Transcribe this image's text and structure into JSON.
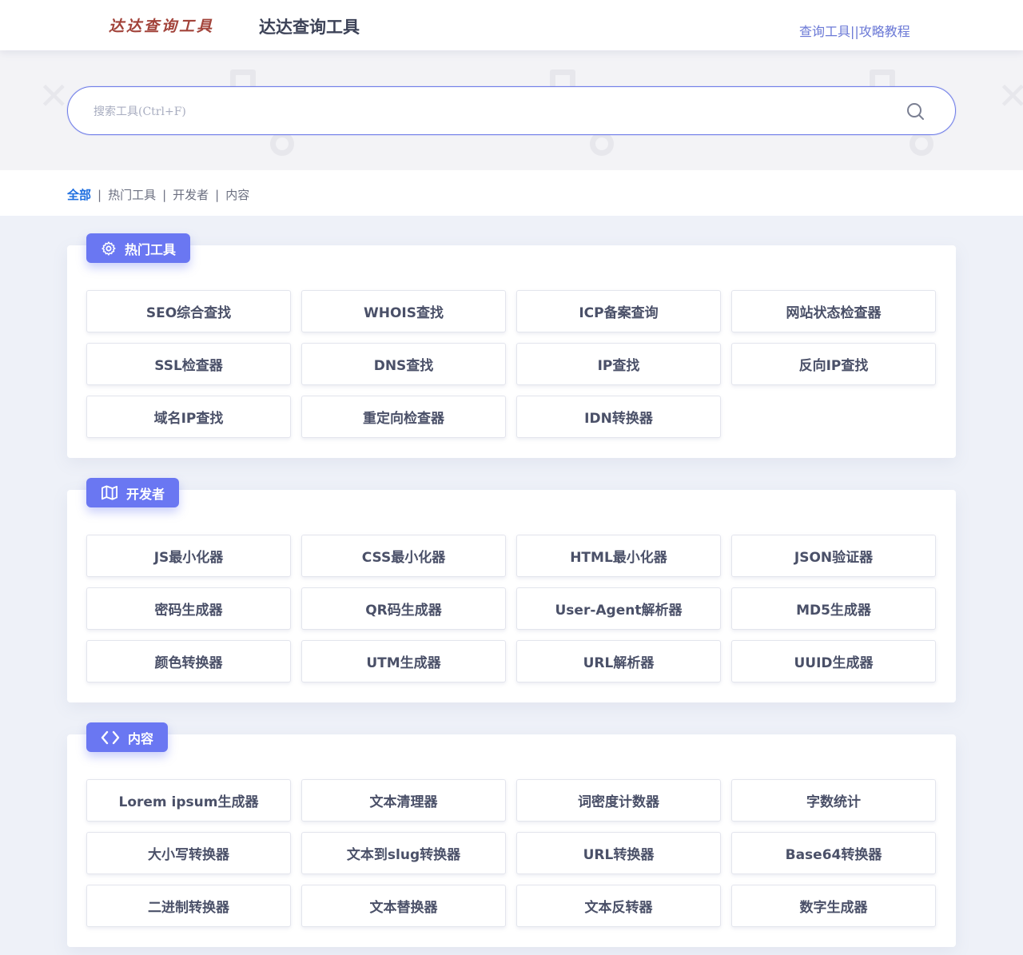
{
  "header": {
    "logo_text": "达达查询工具",
    "site_title": "达达查询工具",
    "links": [
      "查询工具|",
      "|攻略教程"
    ]
  },
  "search": {
    "placeholder": "搜索工具(Ctrl+F)",
    "icon": "search-icon"
  },
  "filters": [
    "全部",
    "热门工具",
    "开发者",
    "内容"
  ],
  "sections": [
    {
      "title": "热门工具",
      "icon": "gear-icon",
      "tools": [
        "SEO综合查找",
        "WHOIS查找",
        "ICP备案查询",
        "网站状态检查器",
        "SSL检查器",
        "DNS查找",
        "IP查找",
        "反向IP查找",
        "域名IP查找",
        "重定向检查器",
        "IDN转换器"
      ]
    },
    {
      "title": "开发者",
      "icon": "map-icon",
      "tools": [
        "JS最小化器",
        "CSS最小化器",
        "HTML最小化器",
        "JSON验证器",
        "密码生成器",
        "QR码生成器",
        "User-Agent解析器",
        "MD5生成器",
        "颜色转换器",
        "UTM生成器",
        "URL解析器",
        "UUID生成器"
      ]
    },
    {
      "title": "内容",
      "icon": "code-icon",
      "tools": [
        "Lorem ipsum生成器",
        "文本清理器",
        "词密度计数器",
        "字数统计",
        "大小写转换器",
        "文本到slug转换器",
        "URL转换器",
        "Base64转换器",
        "二进制转换器",
        "文本替换器",
        "文本反转器",
        "数字生成器"
      ]
    }
  ],
  "colors": {
    "accent": "#6a77f2",
    "active_filter": "#1f6fe0",
    "link": "#6b79d6",
    "page_bg": "#eef1f8"
  }
}
